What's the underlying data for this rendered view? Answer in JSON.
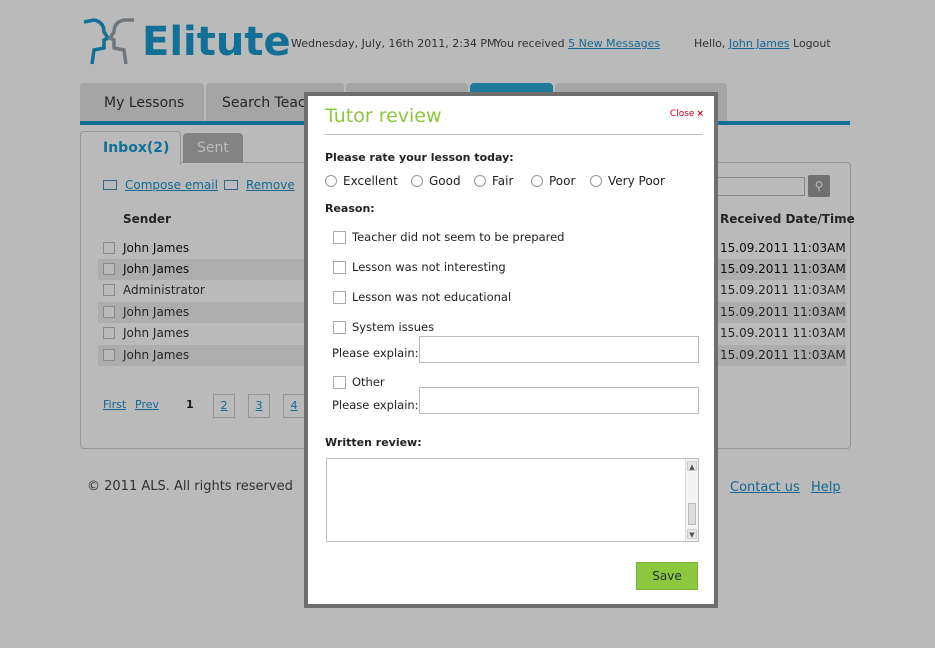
{
  "header": {
    "brand": "Elitute",
    "date": "Wednesday, July, 16th 2011, 2:34 PM",
    "messages_prefix": "You received",
    "messages_link": "5 New Messages",
    "greeting": "Hello,",
    "user_link": "John James",
    "logout": "Logout"
  },
  "main_tabs": [
    "My Lessons",
    "Search Teachers"
  ],
  "inbox": {
    "tab_inbox": "Inbox(2)",
    "tab_sent": "Sent",
    "compose": "Compose email",
    "remove": "Remove",
    "col_sender": "Sender",
    "col_date": "Received Date/Time",
    "rows": [
      {
        "sender": "John James",
        "date": "15.09.2011  11:03AM",
        "unread": true
      },
      {
        "sender": "John James",
        "date": "15.09.2011  11:03AM",
        "unread": true
      },
      {
        "sender": "Administrator",
        "date": "15.09.2011  11:03AM",
        "unread": false
      },
      {
        "sender": "John James",
        "date": "15.09.2011  11:03AM",
        "unread": false
      },
      {
        "sender": "John James",
        "date": "15.09.2011  11:03AM",
        "unread": false
      },
      {
        "sender": "John James",
        "date": "15.09.2011  11:03AM",
        "unread": false
      }
    ],
    "pager": {
      "first": "First",
      "prev": "Prev",
      "current": "1",
      "pages": [
        "2",
        "3",
        "4"
      ]
    }
  },
  "footer": {
    "copyright": "© 2011 ALS. All rights reserved",
    "contact": "Contact us",
    "help": "Help"
  },
  "modal": {
    "title": "Tutor review",
    "close": "Close",
    "rate_label": "Please rate your lesson today:",
    "ratings": [
      "Excellent",
      "Good",
      "Fair",
      "Poor",
      "Very Poor"
    ],
    "reason_label": "Reason:",
    "reasons": [
      "Teacher did not seem to be prepared",
      "Lesson was not interesting",
      "Lesson was not educational",
      "System issues"
    ],
    "explain_label": "Please explain:",
    "other": "Other",
    "written_label": "Written review:",
    "save": "Save"
  },
  "colors": {
    "brand": "#1a9ad0",
    "accent_green": "#8dc63f",
    "close_red": "#d0021b"
  }
}
